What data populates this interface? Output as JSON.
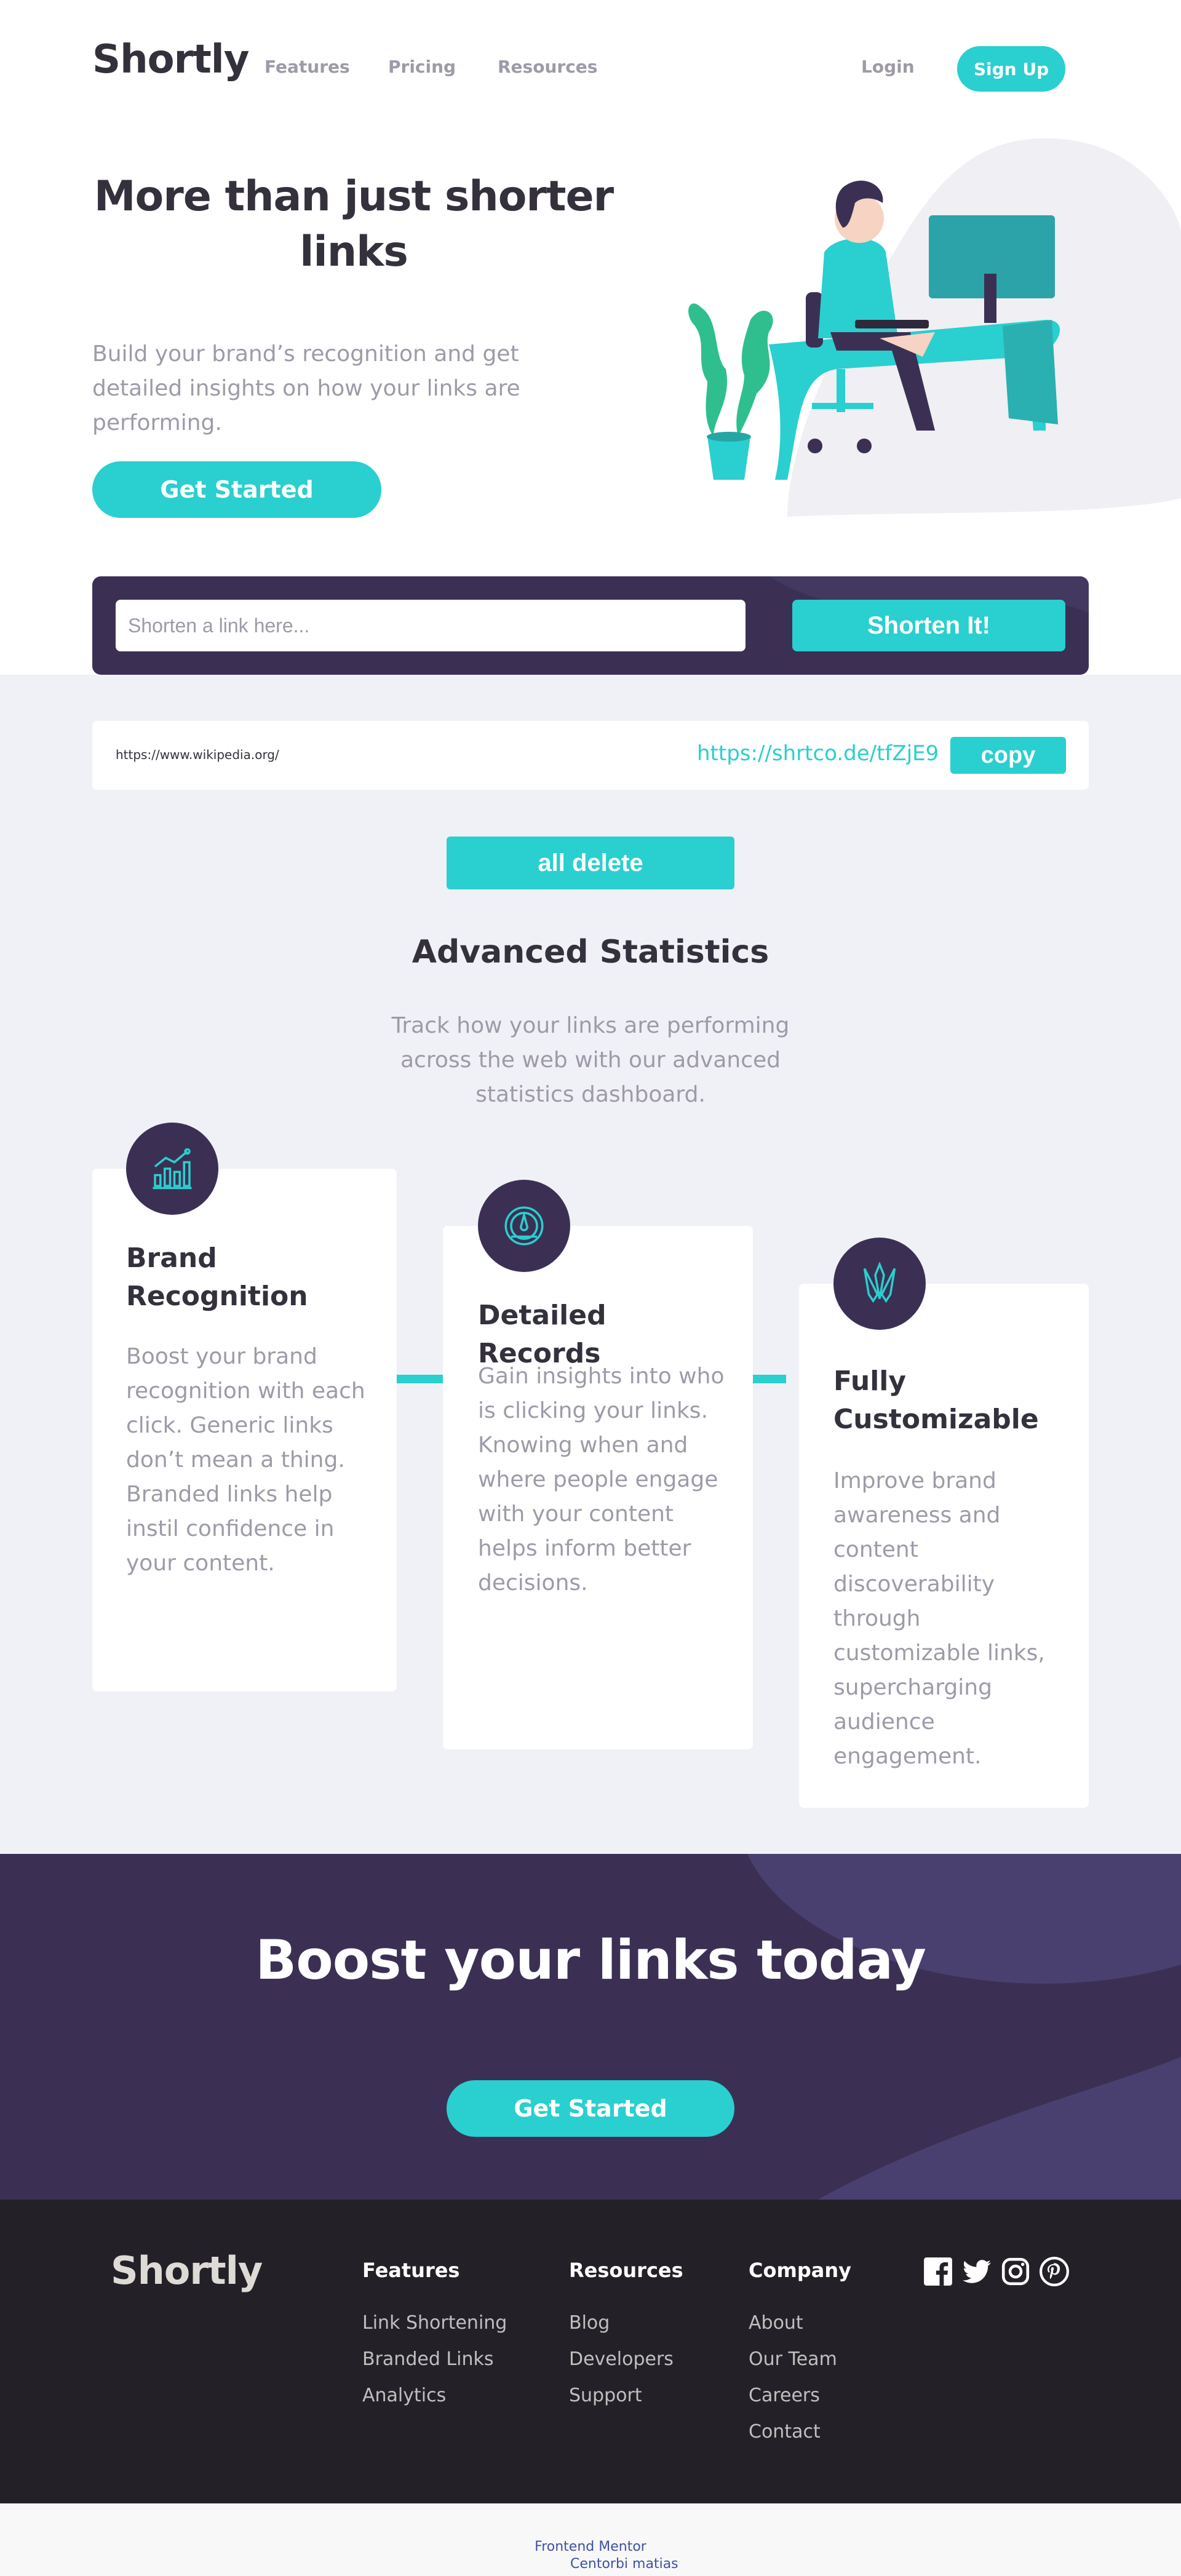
{
  "header": {
    "logo": "Shortly",
    "nav": [
      {
        "label": "Features"
      },
      {
        "label": "Pricing"
      },
      {
        "label": "Resources"
      }
    ],
    "login": "Login",
    "signup": "Sign Up"
  },
  "hero": {
    "title": "More than just shorter links",
    "subtitle": "Build your brand’s recognition and get detailed insights on how your links are performing.",
    "cta": "Get Started"
  },
  "shorten": {
    "placeholder": "Shorten a link here...",
    "button": "Shorten It!"
  },
  "results": [
    {
      "original": "https://www.wikipedia.org/",
      "short": "https://shrtco.de/tfZjE9",
      "copy_label": "copy"
    }
  ],
  "all_delete": "all delete",
  "statistics": {
    "title": "Advanced Statistics",
    "subtitle": "Track how your links are performing across the web with our advanced statistics dashboard.",
    "cards": [
      {
        "icon": "brand-recognition-icon",
        "title": "Brand Recognition",
        "text": "Boost your brand recognition with each click. Generic links don’t mean a thing. Branded links help instil confidence in your content."
      },
      {
        "icon": "detailed-records-icon",
        "title": "Detailed Records",
        "text": "Gain insights into who is clicking your links. Knowing when and where people engage with your content helps inform better decisions."
      },
      {
        "icon": "fully-customizable-icon",
        "title": "Fully Customizable",
        "text": "Improve brand awareness and content discoverability through customizable links, supercharging audience engagement."
      }
    ]
  },
  "boost": {
    "title": "Boost your links today",
    "cta": "Get Started"
  },
  "footer": {
    "logo": "Shortly",
    "columns": [
      {
        "heading": "Features",
        "links": [
          "Link Shortening",
          "Branded Links",
          "Analytics"
        ]
      },
      {
        "heading": "Resources",
        "links": [
          "Blog",
          "Developers",
          "Support"
        ]
      },
      {
        "heading": "Company",
        "links": [
          "About",
          "Our Team",
          "Careers",
          "Contact"
        ]
      }
    ],
    "social": [
      "facebook-icon",
      "twitter-icon",
      "instagram-icon",
      "pinterest-icon"
    ]
  },
  "attribution": {
    "line1": "Frontend Mentor",
    "line2": "Centorbi matias"
  },
  "colors": {
    "cyan": "#2acfcf",
    "dark_violet": "#3b3054",
    "grey_bg": "#f0f1f6",
    "footer_bg": "#232127"
  }
}
